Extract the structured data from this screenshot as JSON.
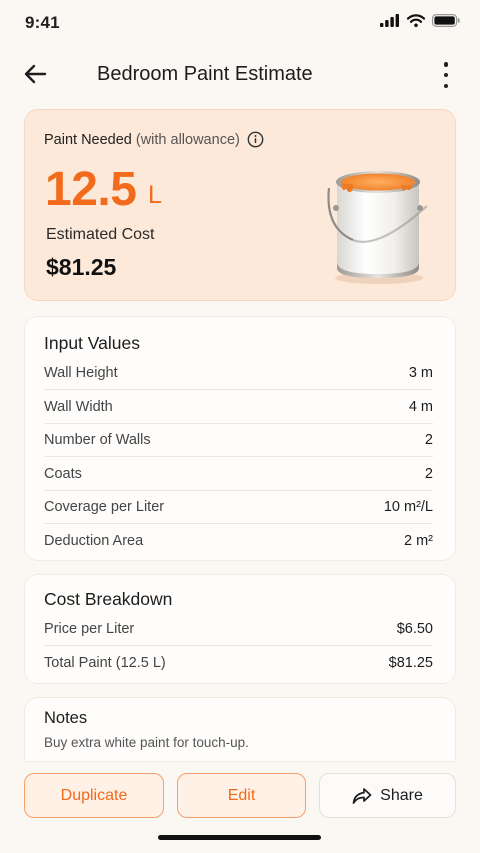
{
  "status_bar": {
    "time": "9:41"
  },
  "header": {
    "title": "Bedroom Paint Estimate"
  },
  "summary": {
    "label": "Paint Needed",
    "label_sub": "(with allowance)",
    "paint_value": "12.5",
    "paint_unit": "L",
    "cost_label": "Estimated Cost",
    "cost_value": "$81.25"
  },
  "inputs": {
    "title": "Input Values",
    "rows": [
      {
        "label": "Wall Height",
        "value": "3 m"
      },
      {
        "label": "Wall Width",
        "value": "4 m"
      },
      {
        "label": "Number of Walls",
        "value": "2"
      },
      {
        "label": "Coats",
        "value": "2"
      },
      {
        "label": "Coverage per Liter",
        "value": "10 m²/L"
      },
      {
        "label": "Deduction Area",
        "value": "2 m²"
      }
    ]
  },
  "cost_breakdown": {
    "title": "Cost Breakdown",
    "rows": [
      {
        "label": "Price per Liter",
        "value": "$6.50"
      },
      {
        "label": "Total Paint (12.5 L)",
        "value": "$81.25"
      }
    ]
  },
  "notes": {
    "title": "Notes",
    "text": "Buy extra white paint for touch-up."
  },
  "actions": {
    "duplicate_label": "Duplicate",
    "edit_label": "Edit",
    "share_label": "Share"
  },
  "icons": {
    "back": "arrow-left-icon",
    "more": "more-vertical-icon",
    "info": "info-icon",
    "share": "share-icon",
    "paint_can": "paint-can-illustration"
  },
  "colors": {
    "accent": "#f26a1b",
    "summary_bg": "#fde9d9",
    "page_bg": "#fbf8f4"
  }
}
